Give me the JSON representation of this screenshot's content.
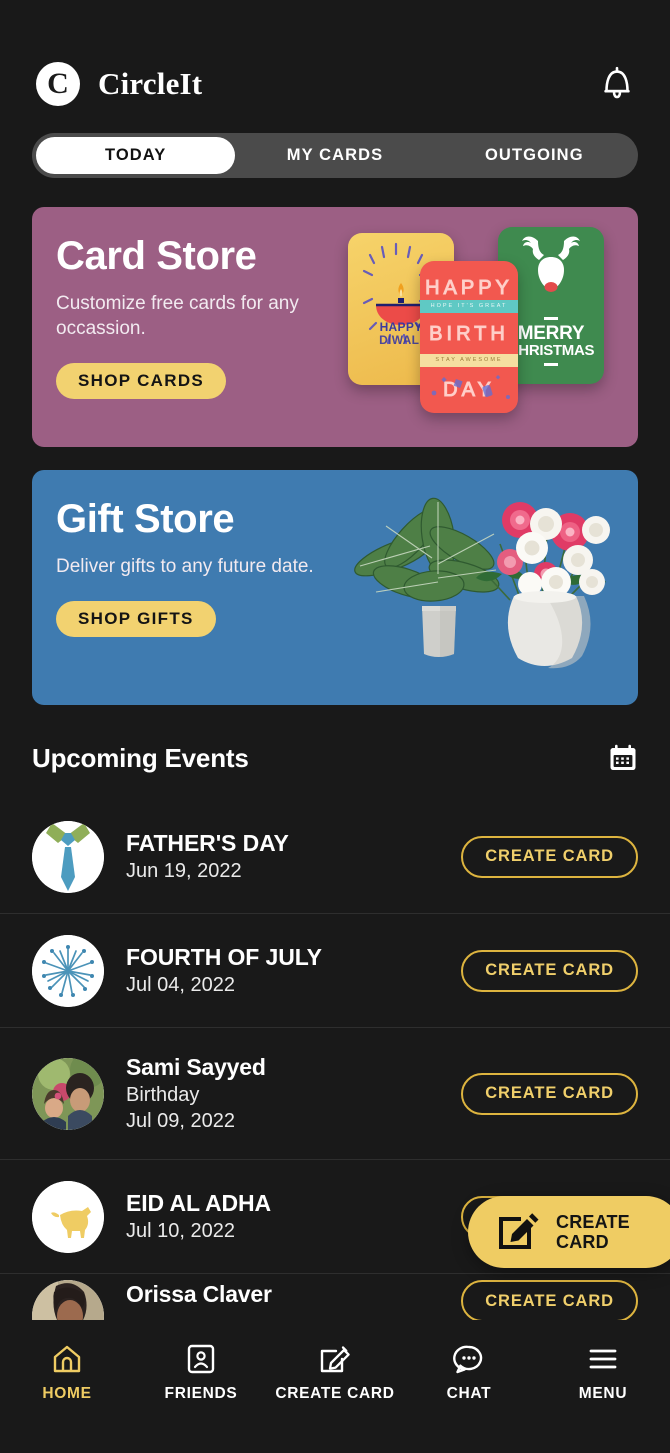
{
  "header": {
    "logo_letter": "C",
    "logo_icon": "circleit-logo-icon",
    "brand": "CircleIt",
    "bell_icon": "bell-icon"
  },
  "tabs": [
    {
      "label": "TODAY",
      "active": true
    },
    {
      "label": "MY CARDS",
      "active": false
    },
    {
      "label": "OUTGOING",
      "active": false
    }
  ],
  "banners": {
    "card_store": {
      "title": "Card Store",
      "subtitle": "Customize free cards for any occassion.",
      "cta": "SHOP CARDS",
      "bg": "#9c5f84",
      "cta_bg": "#f2d270",
      "art": {
        "diwali": {
          "line1": "HAPPY",
          "line2": "DIWALI",
          "bg": "#f0c257"
        },
        "birthday": {
          "w1": "HAPPY",
          "w2": "BIRTH",
          "w3": "DAY",
          "band1": "HOPE IT'S GREAT",
          "band2": "STAY AWESOME",
          "bg": "#f2584f"
        },
        "christmas": {
          "line1": "MERRY",
          "line2": "CHRISTMAS",
          "bg": "#3f8a4f"
        }
      }
    },
    "gift_store": {
      "title": "Gift Store",
      "subtitle": "Deliver gifts to any future date.",
      "cta": "SHOP GIFTS",
      "bg": "#3f7bb0",
      "cta_bg": "#f2d270",
      "art": "potted-plants-and-flowers-image"
    }
  },
  "upcoming": {
    "title": "Upcoming Events",
    "calendar_icon": "calendar-icon",
    "button_label": "CREATE CARD",
    "events": [
      {
        "name": "FATHER'S DAY",
        "occasion": "",
        "date": "Jun 19, 2022",
        "avatar": "necktie-icon",
        "action": "CREATE CARD"
      },
      {
        "name": "FOURTH OF JULY",
        "occasion": "",
        "date": "Jul 04, 2022",
        "avatar": "fireworks-icon",
        "action": "CREATE CARD"
      },
      {
        "name": "Sami Sayyed",
        "occasion": "Birthday",
        "date": "Jul 09, 2022",
        "avatar": "person-photo-avatar",
        "action": "CREATE CARD"
      },
      {
        "name": "EID AL ADHA",
        "occasion": "",
        "date": "Jul 10, 2022",
        "avatar": "crescent-goat-icon",
        "action": "CREATE CARD"
      },
      {
        "name": "Orissa Claver",
        "occasion": "",
        "date": "",
        "avatar": "person-photo-avatar",
        "action": "CREATE CARD"
      }
    ]
  },
  "fab": {
    "line1": "CREATE",
    "line2": "CARD",
    "icon": "compose-card-icon",
    "bg": "#efcc63"
  },
  "bottom_nav": [
    {
      "label": "HOME",
      "icon": "home-icon",
      "active": true
    },
    {
      "label": "FRIENDS",
      "icon": "contact-card-icon",
      "active": false
    },
    {
      "label": "CREATE CARD",
      "icon": "compose-card-icon",
      "active": false
    },
    {
      "label": "CHAT",
      "icon": "chat-bubble-icon",
      "active": false
    },
    {
      "label": "MENU",
      "icon": "hamburger-menu-icon",
      "active": false
    }
  ],
  "theme": {
    "background": "#191919",
    "accent": "#efcc63",
    "gold_outline": "#ddb43f"
  }
}
